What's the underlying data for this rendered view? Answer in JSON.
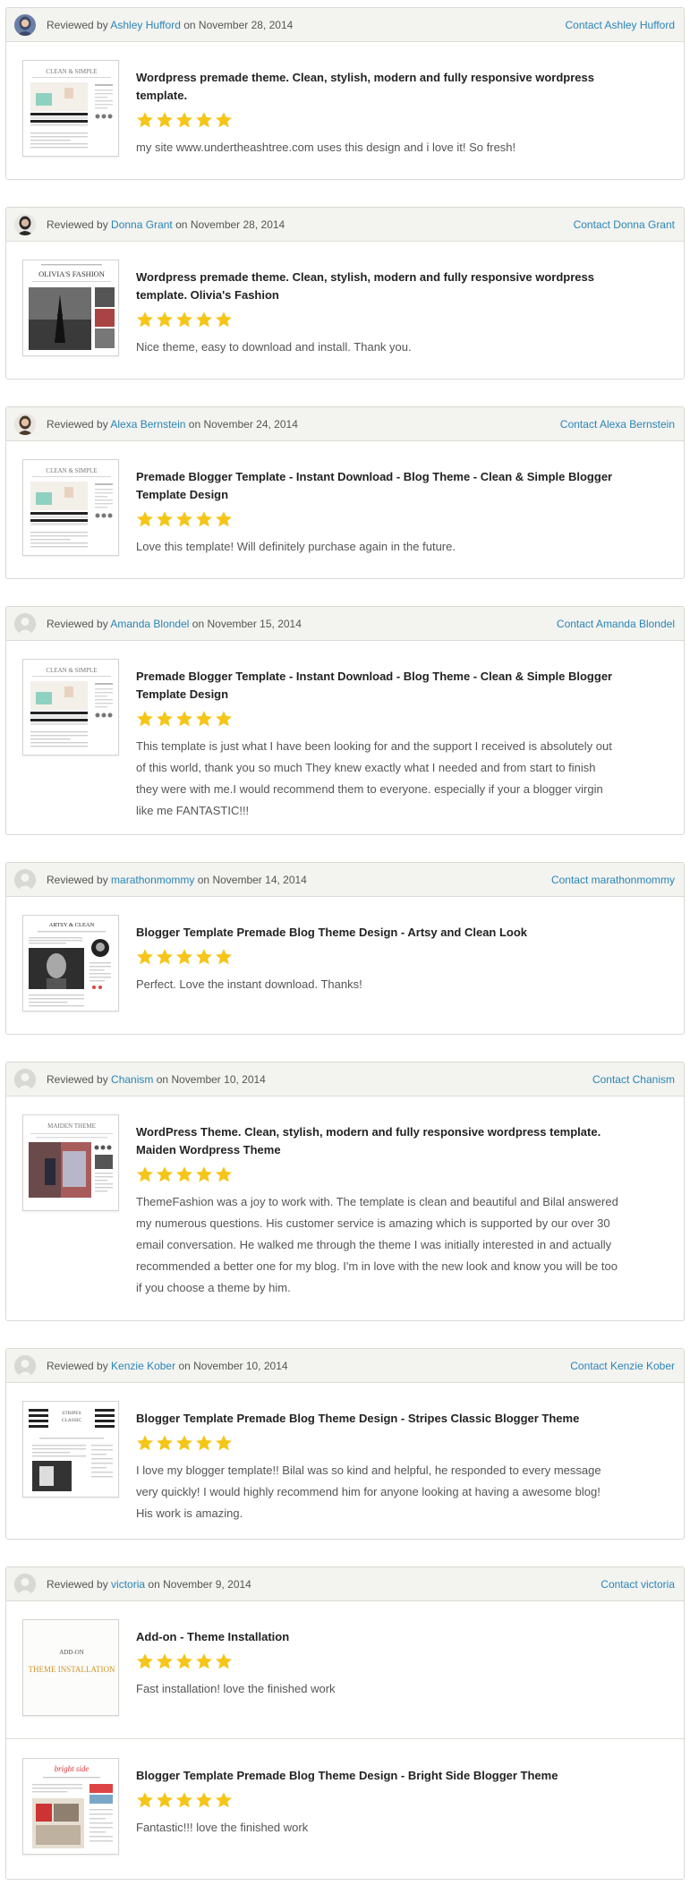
{
  "labels": {
    "reviewed_by": "Reviewed by",
    "on": "on",
    "contact_prefix": "Contact"
  },
  "colors": {
    "link": "#2a85b8",
    "star": "#f5c518",
    "header_bg": "#f3f3ef",
    "border": "#d9d9d4"
  },
  "reviews": [
    {
      "reviewer": "Ashley Hufford",
      "date": "November 28, 2014",
      "contact_label": "Contact Ashley Hufford",
      "avatar": "photo-avatar",
      "items": [
        {
          "title": "Wordpress premade theme. Clean, stylish, modern and fully responsive wordpress template.",
          "rating": 5,
          "text": "my site www.undertheashtree.com uses this design and i love it! So fresh!",
          "thumbnail": {
            "kind": "clean-simple",
            "heading": "CLEAN & SIMPLE"
          }
        }
      ]
    },
    {
      "reviewer": "Donna Grant",
      "date": "November 28, 2014",
      "contact_label": "Contact Donna Grant",
      "avatar": "photo-avatar",
      "items": [
        {
          "title": "Wordpress premade theme. Clean, stylish, modern and fully responsive wordpress template. Olivia's Fashion",
          "rating": 5,
          "text": "Nice theme, easy to download and install. Thank you.",
          "thumbnail": {
            "kind": "olivias-fashion",
            "heading": "OLIVIA'S FASHION"
          }
        }
      ]
    },
    {
      "reviewer": "Alexa Bernstein",
      "date": "November 24, 2014",
      "contact_label": "Contact Alexa Bernstein",
      "avatar": "photo-avatar",
      "items": [
        {
          "title": "Premade Blogger Template - Instant Download - Blog Theme - Clean & Simple Blogger Template Design",
          "rating": 5,
          "text": "Love this template! Will definitely purchase again in the future.",
          "thumbnail": {
            "kind": "clean-simple",
            "heading": "CLEAN & SIMPLE"
          }
        }
      ]
    },
    {
      "reviewer": "Amanda Blondel",
      "date": "November 15, 2014",
      "contact_label": "Contact Amanda Blondel",
      "avatar": "default-avatar",
      "items": [
        {
          "title": "Premade Blogger Template - Instant Download - Blog Theme - Clean & Simple Blogger Template Design",
          "rating": 5,
          "text": "This template is just what I have been looking for and the support I received is absolutely out of this world, thank you so much They knew exactly what I needed and from start to finish they were with me.I would recommend them to everyone. especially if your a blogger virgin like me FANTASTIC!!!",
          "thumbnail": {
            "kind": "clean-simple",
            "heading": "CLEAN & SIMPLE"
          }
        }
      ]
    },
    {
      "reviewer": "marathonmommy",
      "date": "November 14, 2014",
      "contact_label": "Contact marathonmommy",
      "avatar": "default-avatar",
      "items": [
        {
          "title": "Blogger Template Premade Blog Theme Design - Artsy and Clean Look",
          "rating": 5,
          "text": "Perfect. Love the instant download. Thanks!",
          "thumbnail": {
            "kind": "artsy-clean",
            "heading": "ARTSY & CLEAN"
          }
        }
      ]
    },
    {
      "reviewer": "Chanism",
      "date": "November 10, 2014",
      "contact_label": "Contact Chanism",
      "avatar": "default-avatar",
      "items": [
        {
          "title": "WordPress Theme. Clean, stylish, modern and fully responsive wordpress template. Maiden Wordpress Theme",
          "rating": 5,
          "text": "ThemeFashion was a joy to work with. The template is clean and beautiful and Bilal answered my numerous questions. His customer service is amazing which is supported by our over 30 email conversation. He walked me through the theme I was initially interested in and actually recommended a better one for my blog. I'm in love with the new look and know you will be too if you choose a theme by him.",
          "thumbnail": {
            "kind": "maiden",
            "heading": "MAIDEN THEME"
          }
        }
      ]
    },
    {
      "reviewer": "Kenzie Kober",
      "date": "November 10, 2014",
      "contact_label": "Contact Kenzie Kober",
      "avatar": "default-avatar",
      "items": [
        {
          "title": "Blogger Template Premade Blog Theme Design - Stripes Classic Blogger Theme",
          "rating": 5,
          "text": "I love my blogger template!! Bilal was so kind and helpful, he responded to every message very quickly! I would highly recommend him for anyone looking at having a awesome blog! His work is amazing.",
          "thumbnail": {
            "kind": "stripes",
            "heading": "STRIPES CLASSIC"
          }
        }
      ]
    },
    {
      "reviewer": "victoria",
      "date": "November 9, 2014",
      "contact_label": "Contact victoria",
      "avatar": "default-avatar",
      "items": [
        {
          "title": "Add-on - Theme Installation",
          "rating": 5,
          "text": "Fast installation! love the finished work",
          "thumbnail": {
            "kind": "addon",
            "heading": "ADD-ON",
            "subheading": "THEME INSTALLATION"
          }
        },
        {
          "title": "Blogger Template Premade Blog Theme Design - Bright Side Blogger Theme",
          "rating": 5,
          "text": "Fantastic!!! love the finished work",
          "thumbnail": {
            "kind": "bright-side",
            "heading": "bright side"
          }
        }
      ]
    }
  ]
}
